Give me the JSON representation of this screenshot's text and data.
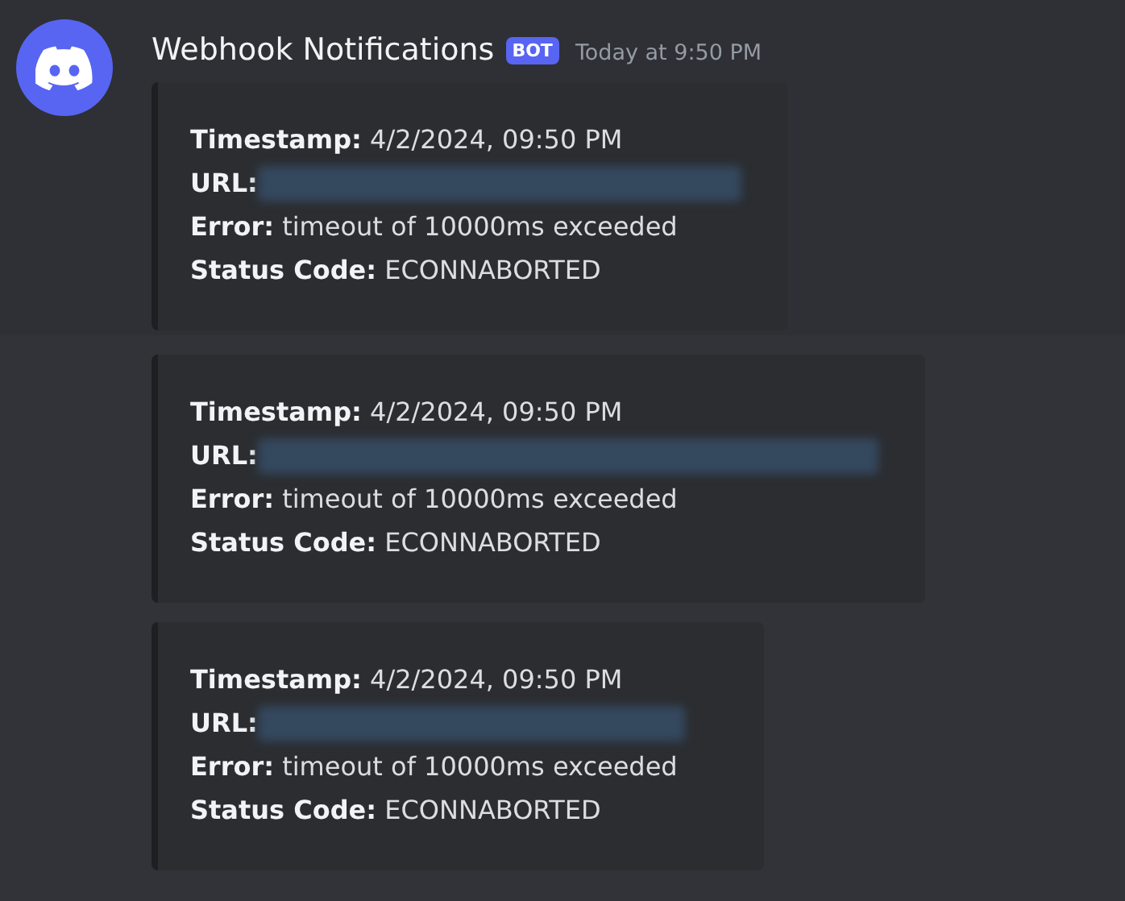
{
  "message": {
    "author": "Webhook Notifications",
    "badge": "BOT",
    "time": "Today at 9:50 PM"
  },
  "embeds": [
    {
      "lines": [
        {
          "kind": "text",
          "text": "**Timestamp:** 4/2/2024, 09:50 PM"
        },
        {
          "kind": "redacted",
          "text": "**URL:**"
        },
        {
          "kind": "text",
          "text": "**Error:** timeout of 10000ms exceeded"
        },
        {
          "kind": "text",
          "text": "**Status Code:** ECONNABORTED"
        }
      ]
    },
    {
      "lines": [
        {
          "kind": "text",
          "text": "**Timestamp:** 4/2/2024, 09:50 PM"
        },
        {
          "kind": "redacted",
          "text": "**URL:**"
        },
        {
          "kind": "text",
          "text": "**Error:** timeout of 10000ms exceeded"
        },
        {
          "kind": "text",
          "text": "**Status Code:** ECONNABORTED"
        }
      ]
    },
    {
      "lines": [
        {
          "kind": "text",
          "text": "**Timestamp:** 4/2/2024, 09:50 PM"
        },
        {
          "kind": "redacted",
          "text": "**URL:**"
        },
        {
          "kind": "text",
          "text": "**Error:** timeout of 10000ms exceeded"
        },
        {
          "kind": "text",
          "text": "**Status Code:** ECONNABORTED"
        }
      ]
    }
  ]
}
